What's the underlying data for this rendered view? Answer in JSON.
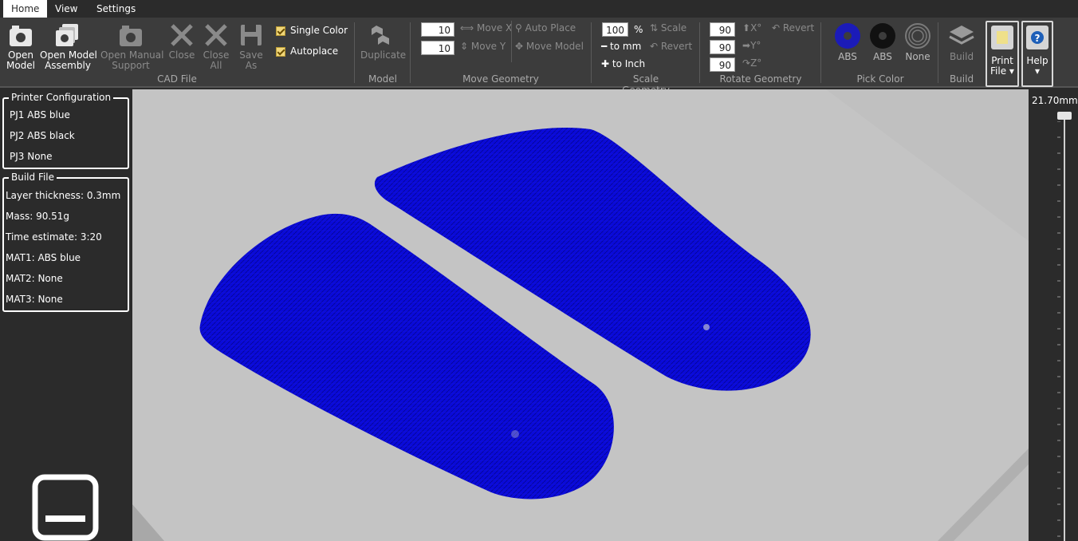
{
  "menu": {
    "tabs": [
      "Home",
      "View",
      "Settings"
    ]
  },
  "ribbon": {
    "cad": {
      "open_model": "Open\nModel",
      "open_model_assembly": "Open Model\nAssembly",
      "open_manual_support": "Open Manual\nSupport",
      "close": "Close",
      "close_all": "Close\nAll",
      "save_as": "Save\nAs",
      "single_color": "Single Color",
      "autoplace": "Autoplace",
      "group": "CAD File"
    },
    "model": {
      "duplicate": "Duplicate",
      "group": "Model"
    },
    "move": {
      "x_value": "10",
      "y_value": "10",
      "move_x": "Move X",
      "move_y": "Move Y",
      "auto_place": "Auto Place",
      "move_model": "Move Model",
      "group": "Move Geometry"
    },
    "scale": {
      "value": "100",
      "percent": "%",
      "scale": "Scale",
      "to_mm": "to mm",
      "revert": "Revert",
      "to_inch": "to Inch",
      "group": "Scale Geometry"
    },
    "rotate": {
      "x_value": "90",
      "y_value": "90",
      "z_value": "90",
      "x": "X°",
      "y": "Y°",
      "z": "Z°",
      "revert": "Revert",
      "group": "Rotate Geometry"
    },
    "color": {
      "abs1": "ABS",
      "abs2": "ABS",
      "none": "None",
      "group": "Pick Color",
      "swatch1": "#1b1bb8",
      "swatch2": "#111111"
    },
    "build": {
      "label": "Build",
      "group": "Build"
    },
    "print": {
      "label": "Print\nFile ▾"
    },
    "help": {
      "label": "Help\n▾"
    }
  },
  "printer_config": {
    "title": "Printer Configuration",
    "rows": [
      "PJ1  ABS blue",
      "PJ2  ABS black",
      "PJ3  None"
    ]
  },
  "build_file": {
    "title": "Build File",
    "rows": [
      "Layer thickness:   0.3mm",
      "Mass:   90.51g",
      "Time estimate:   3:20",
      "MAT1:  ABS blue",
      "MAT2:  None",
      "MAT3:  None"
    ]
  },
  "ruler": {
    "height_label": "21.70mm"
  },
  "colors": {
    "model": "#0a0ad8",
    "platform": "#c4c4c4"
  }
}
